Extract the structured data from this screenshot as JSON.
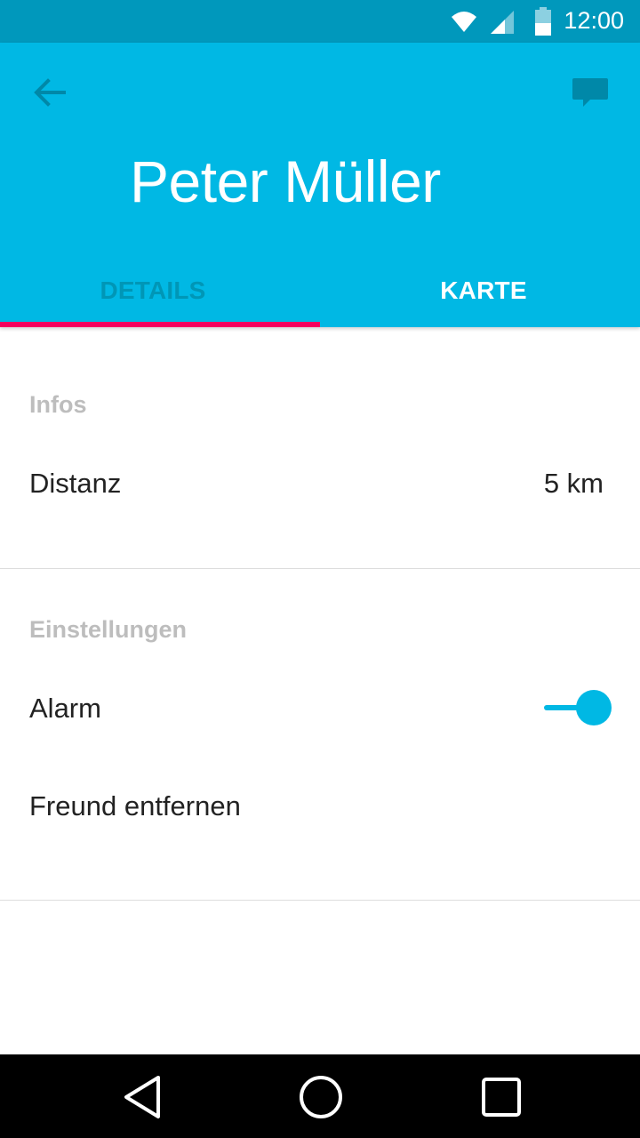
{
  "status_bar": {
    "time": "12:00",
    "icons": [
      "wifi-icon",
      "cellular-signal-icon",
      "battery-icon"
    ]
  },
  "header": {
    "title": "Peter Müller",
    "back_icon": "arrow-back-icon",
    "action_icon": "chat-icon",
    "tabs": [
      {
        "label": "DETAILS",
        "selected": true
      },
      {
        "label": "KARTE",
        "selected": false
      }
    ]
  },
  "sections": {
    "infos": {
      "header": "Infos",
      "distance_label": "Distanz",
      "distance_value": "5 km"
    },
    "settings": {
      "header": "Einstellungen",
      "alarm_label": "Alarm",
      "alarm_enabled": true,
      "remove_friend_label": "Freund entfernen"
    }
  },
  "nav_bar": {
    "icons": [
      "back-triangle-icon",
      "home-circle-icon",
      "recents-square-icon"
    ]
  },
  "colors": {
    "status_bar": "#0098BC",
    "primary": "#00B8E4",
    "accent": "#F5005D",
    "inactive_tab": "#0096B6",
    "section_header": "#BDBDBD"
  }
}
